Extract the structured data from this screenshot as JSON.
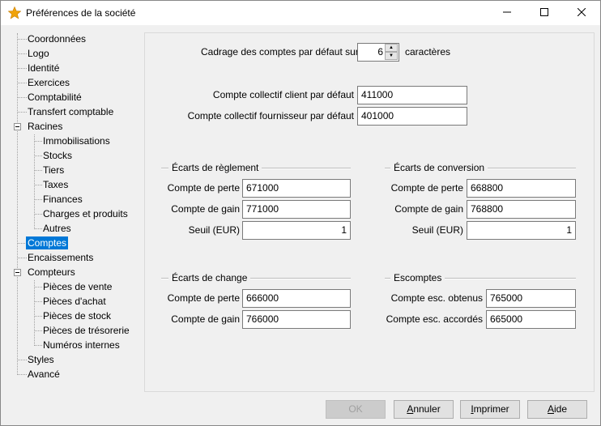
{
  "window": {
    "title": "Préférences de la société",
    "icon": "star-icon",
    "icon_color": "#f0a30a"
  },
  "tree": {
    "items": [
      {
        "label": "Coordonnées"
      },
      {
        "label": "Logo"
      },
      {
        "label": "Identité"
      },
      {
        "label": "Exercices"
      },
      {
        "label": "Comptabilité"
      },
      {
        "label": "Transfert comptable"
      },
      {
        "label": "Racines"
      },
      {
        "label": "Immobilisations"
      },
      {
        "label": "Stocks"
      },
      {
        "label": "Tiers"
      },
      {
        "label": "Taxes"
      },
      {
        "label": "Finances"
      },
      {
        "label": "Charges et produits"
      },
      {
        "label": "Autres"
      },
      {
        "label": "Comptes"
      },
      {
        "label": "Encaissements"
      },
      {
        "label": "Compteurs"
      },
      {
        "label": "Pièces de vente"
      },
      {
        "label": "Pièces d'achat"
      },
      {
        "label": "Pièces de stock"
      },
      {
        "label": "Pièces de trésorerie"
      },
      {
        "label": "Numéros internes"
      },
      {
        "label": "Styles"
      },
      {
        "label": "Avancé"
      }
    ],
    "selected": "Comptes",
    "selection_color": "#0078d7"
  },
  "form": {
    "cadrage": {
      "label": "Cadrage des comptes par défaut sur",
      "value": "6",
      "suffix": "caractères"
    },
    "compte_client": {
      "label": "Compte collectif client par défaut",
      "value": "411000"
    },
    "compte_fournisseur": {
      "label": "Compte collectif fournisseur par défaut",
      "value": "401000"
    },
    "ecarts_reglement": {
      "title": "Écarts de règlement",
      "perte_label": "Compte de perte",
      "perte_value": "671000",
      "gain_label": "Compte de gain",
      "gain_value": "771000",
      "seuil_label": "Seuil (EUR)",
      "seuil_value": "1"
    },
    "ecarts_conversion": {
      "title": "Écarts de conversion",
      "perte_label": "Compte de perte",
      "perte_value": "668800",
      "gain_label": "Compte de gain",
      "gain_value": "768800",
      "seuil_label": "Seuil (EUR)",
      "seuil_value": "1"
    },
    "ecarts_change": {
      "title": "Écarts de change",
      "perte_label": "Compte de perte",
      "perte_value": "666000",
      "gain_label": "Compte de gain",
      "gain_value": "766000"
    },
    "escomptes": {
      "title": "Escomptes",
      "obtenus_label": "Compte esc. obtenus",
      "obtenus_value": "765000",
      "accordes_label": "Compte esc. accordés",
      "accordes_value": "665000"
    }
  },
  "buttons": {
    "ok": "OK",
    "annuler_u": "A",
    "annuler_rest": "nnuler",
    "imprimer_u": "I",
    "imprimer_rest": "mprimer",
    "aide_u": "A",
    "aide_rest": "ide"
  }
}
